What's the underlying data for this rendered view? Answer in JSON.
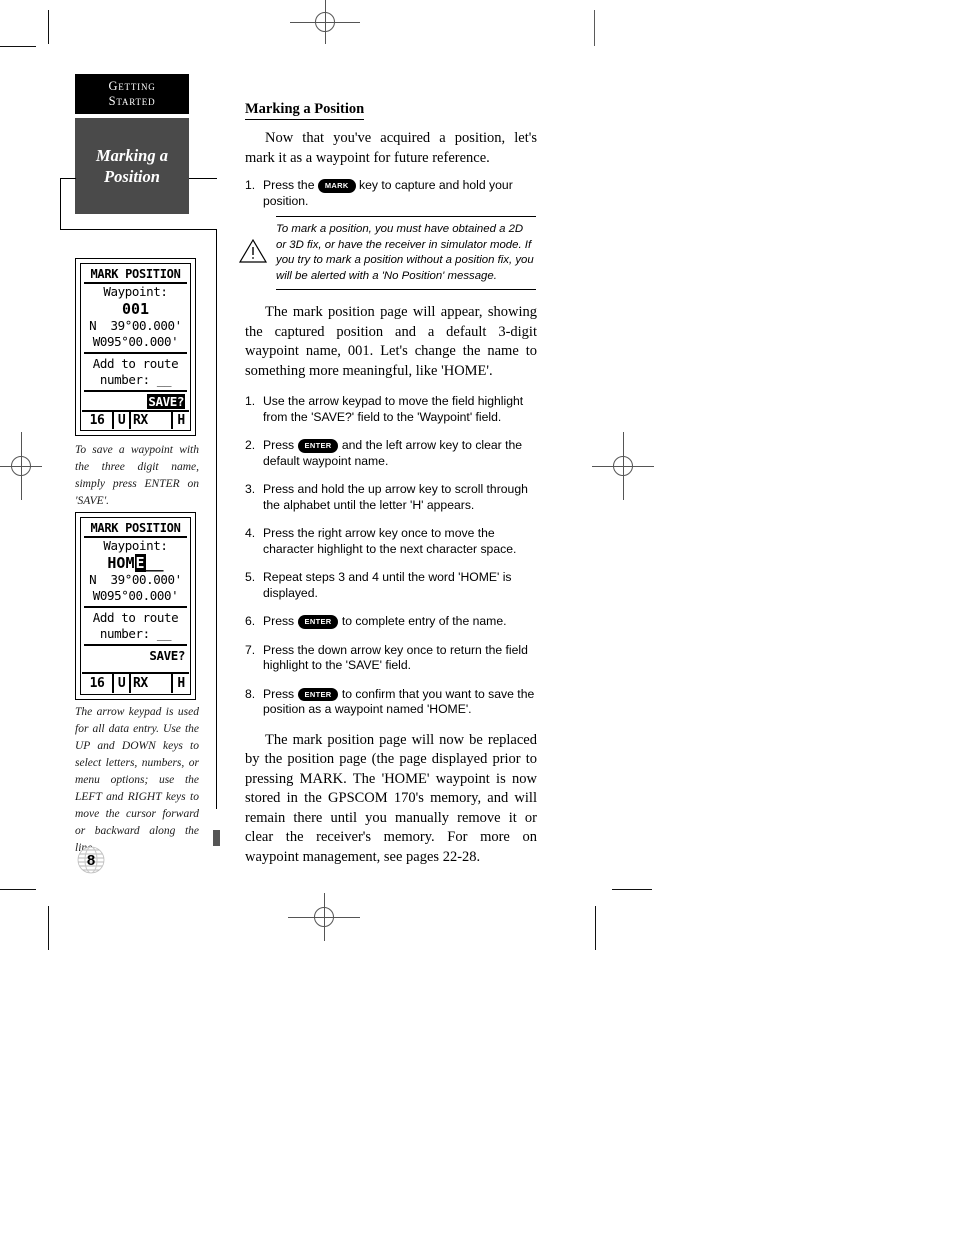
{
  "sidebar": {
    "chapter_tab_line1": "Getting",
    "chapter_tab_line2": "Started",
    "section_tab_line1": "Marking a",
    "section_tab_line2": "Position"
  },
  "screens": [
    {
      "name": "mark-position-default",
      "title": "MARK POSITION",
      "waypoint_label": "Waypoint:",
      "waypoint_value": "001",
      "waypoint_highlighted": false,
      "lat": "N  39°00.000'",
      "lon": "W095°00.000'",
      "route_label_line1": "Add to route",
      "route_label_line2": "number: __",
      "save_label": "SAVE?",
      "save_highlighted": true,
      "status": {
        "sats": "16",
        "unit": "U",
        "mode": "RX",
        "flag": "H"
      }
    },
    {
      "name": "mark-position-home",
      "title": "MARK POSITION",
      "waypoint_label": "Waypoint:",
      "waypoint_value_prefix": "HOM",
      "waypoint_value_cursor": "E",
      "waypoint_value_suffix": "__",
      "waypoint_highlighted": true,
      "lat": "N  39°00.000'",
      "lon": "W095°00.000'",
      "route_label_line1": "Add to route",
      "route_label_line2": "number: __",
      "save_label": "SAVE?",
      "save_highlighted": false,
      "status": {
        "sats": "16",
        "unit": "U",
        "mode": "RX",
        "flag": "H"
      }
    }
  ],
  "captions": {
    "first": "To save a waypoint with the three digit name, simply press ENTER on 'SAVE'.",
    "second": "The arrow keypad is used for all data entry. Use the UP and DOWN keys to select letters, numbers, or menu options; use the LEFT and RIGHT keys to move the cursor forward or backward along the line."
  },
  "main": {
    "heading": "Marking a Position",
    "intro": "Now that you've acquired a position, let's mark it as a waypoint for future reference.",
    "step_first": {
      "num": "1.",
      "pre": "Press the",
      "key": "MARK",
      "post": "key to capture and hold your position."
    },
    "note": "To mark a position, you must have obtained a 2D or 3D fix, or have the receiver in simulator mode. If you try to mark a position without a position fix, you will be alerted with a 'No Position' message.",
    "paragraph2": "The mark position page will appear, showing the captured position and a default 3-digit waypoint name, 001. Let's change the name to something more meaningful, like 'HOME'.",
    "steps": [
      {
        "num": "1.",
        "pre": "Use the arrow keypad to move the field highlight from the 'SAVE?' field to the 'Waypoint' field.",
        "key": "",
        "post": ""
      },
      {
        "num": "2.",
        "pre": "Press",
        "key": "ENTER",
        "post": "and the left arrow key to clear the default waypoint name."
      },
      {
        "num": "3.",
        "pre": "Press and hold the up arrow key to scroll through the alphabet until the letter 'H' appears.",
        "key": "",
        "post": ""
      },
      {
        "num": "4.",
        "pre": "Press the right arrow key once to move the character highlight to the next character space.",
        "key": "",
        "post": ""
      },
      {
        "num": "5.",
        "pre": "Repeat steps 3 and 4 until the word 'HOME' is displayed.",
        "key": "",
        "post": ""
      },
      {
        "num": "6.",
        "pre": "Press",
        "key": "ENTER",
        "post": "to complete entry of the name."
      },
      {
        "num": "7.",
        "pre": "Press the down arrow key once to return the field highlight to the 'SAVE' field.",
        "key": "",
        "post": ""
      },
      {
        "num": "8.",
        "pre": "Press",
        "key": "ENTER",
        "post": "to confirm that you want to save the position as a waypoint named 'HOME'."
      }
    ],
    "paragraph3": "The mark position page will now be replaced by the position page (the page displayed prior to pressing MARK. The 'HOME' waypoint is now stored in the GPSCOM 170's memory, and will remain there until you manually remove it or clear the receiver's memory. For more on waypoint management, see pages 22-28."
  },
  "footer": {
    "page_number": "8"
  },
  "colors": {
    "tab_dark": "#000000",
    "tab_gray": "#4a4a4a",
    "text": "#000000"
  }
}
